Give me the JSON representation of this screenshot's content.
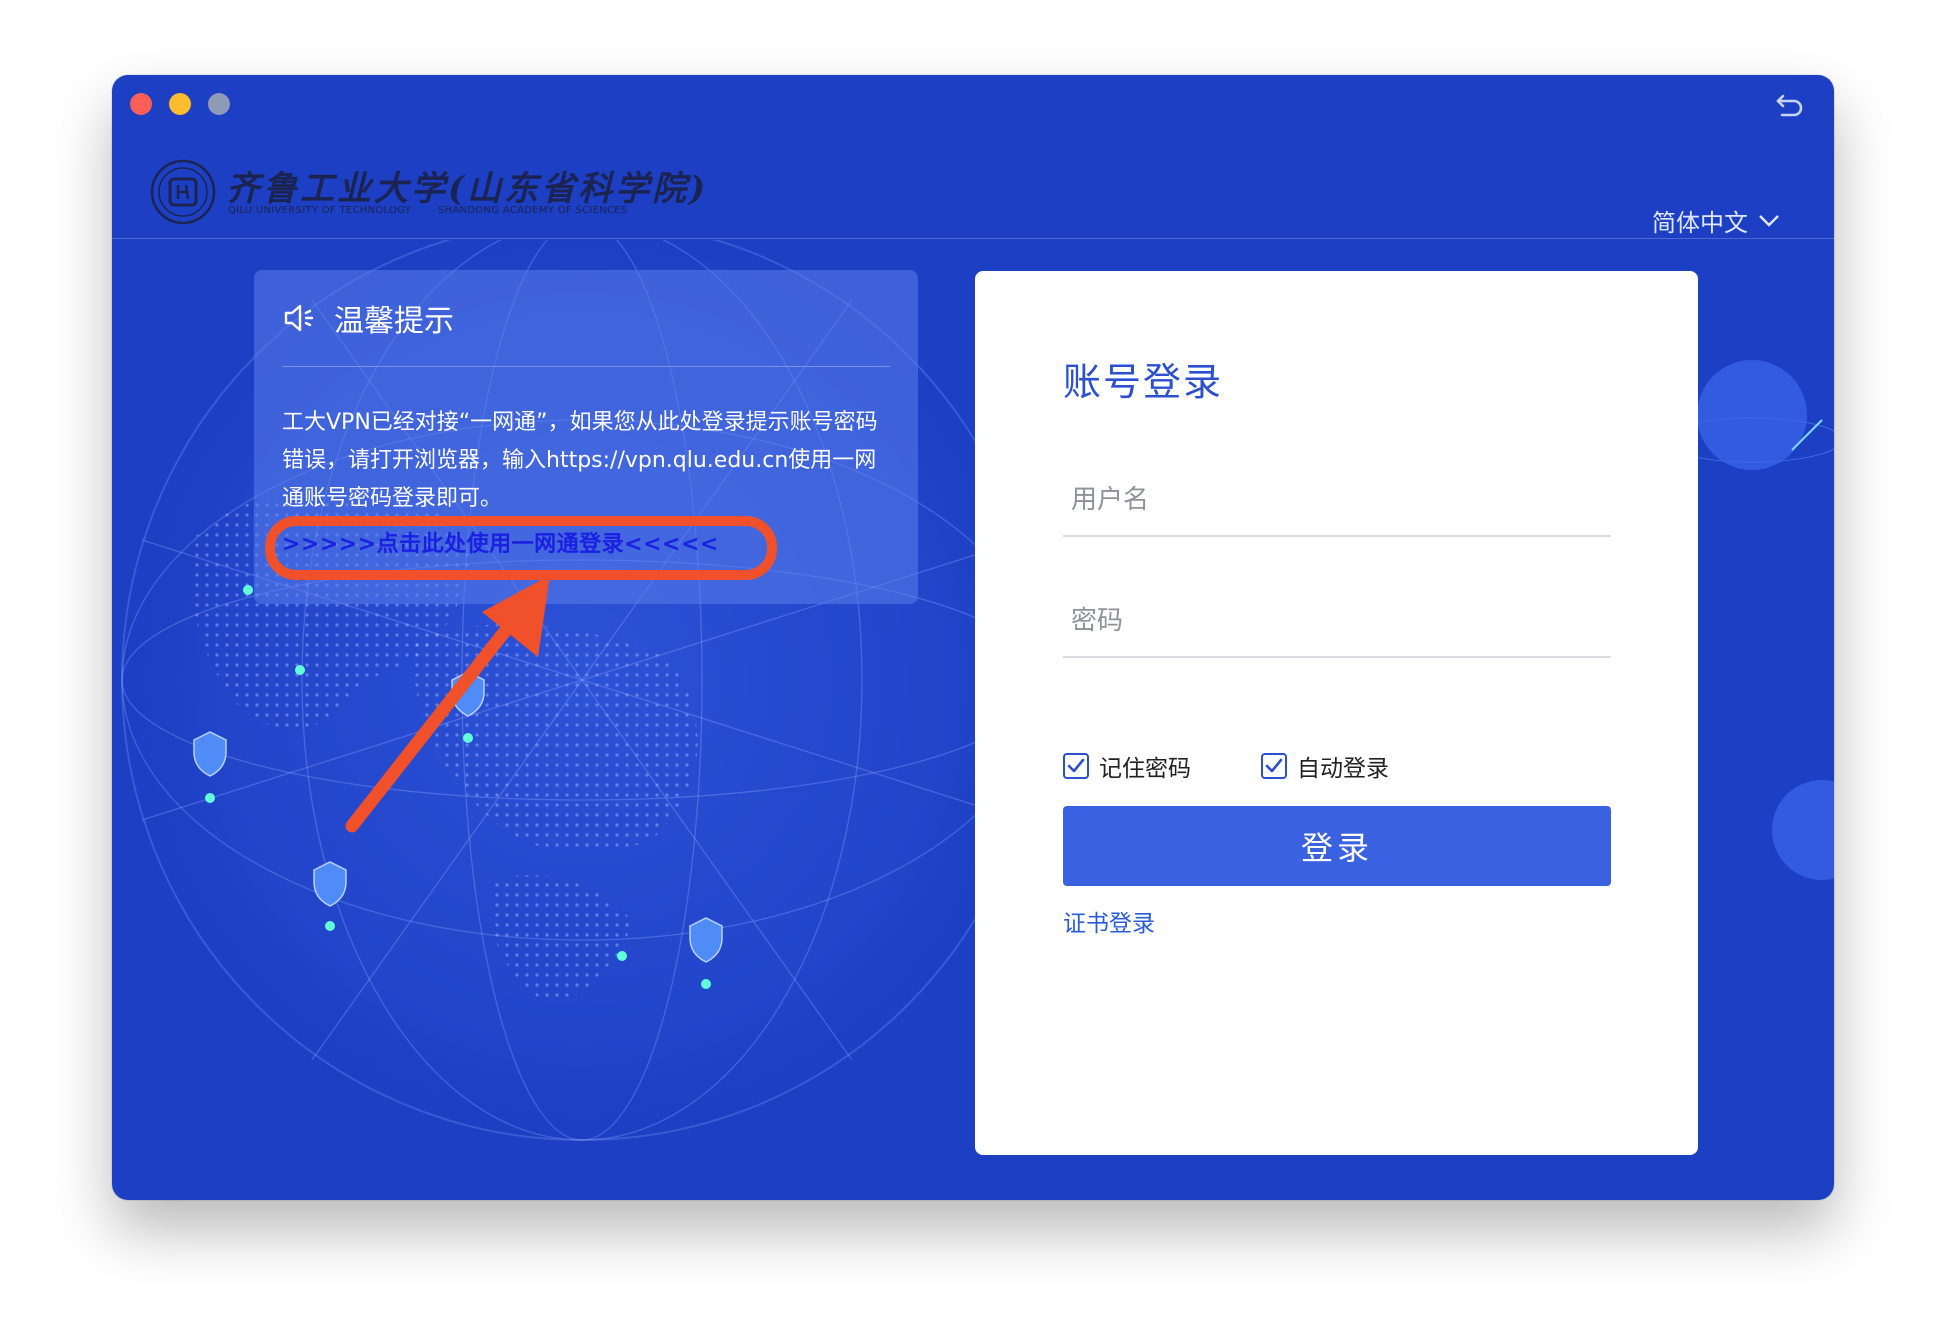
{
  "window": {
    "traffic_lights": [
      "close",
      "minimize",
      "maximize"
    ]
  },
  "header": {
    "logo_cn": "齐鲁工业大学(山东省科学院)",
    "logo_en_left": "QILU UNIVERSITY OF TECHNOLOGY",
    "logo_en_right": "SHANDONG ACADEMY OF SCIENCES",
    "language": "简体中文"
  },
  "notice": {
    "icon": "speaker-icon",
    "title": "温馨提示",
    "body": "工大VPN已经对接“一网通”，如果您从此处登录提示账号密码错误，请打开浏览器，输入https://vpn.qlu.edu.cn使用一网通账号密码登录即可。",
    "link": ">>>>>点击此处使用一网通登录<<<<<"
  },
  "login": {
    "title": "账号登录",
    "username_placeholder": "用户名",
    "password_placeholder": "密码",
    "remember_label": "记住密码",
    "remember_checked": true,
    "autologin_label": "自动登录",
    "autologin_checked": true,
    "submit_label": "登录",
    "cert_link": "证书登录"
  },
  "colors": {
    "window_bg": "#1d3fc3",
    "accent": "#3a62e0",
    "annotation": "#f0502a",
    "link": "#1a1fe0"
  }
}
